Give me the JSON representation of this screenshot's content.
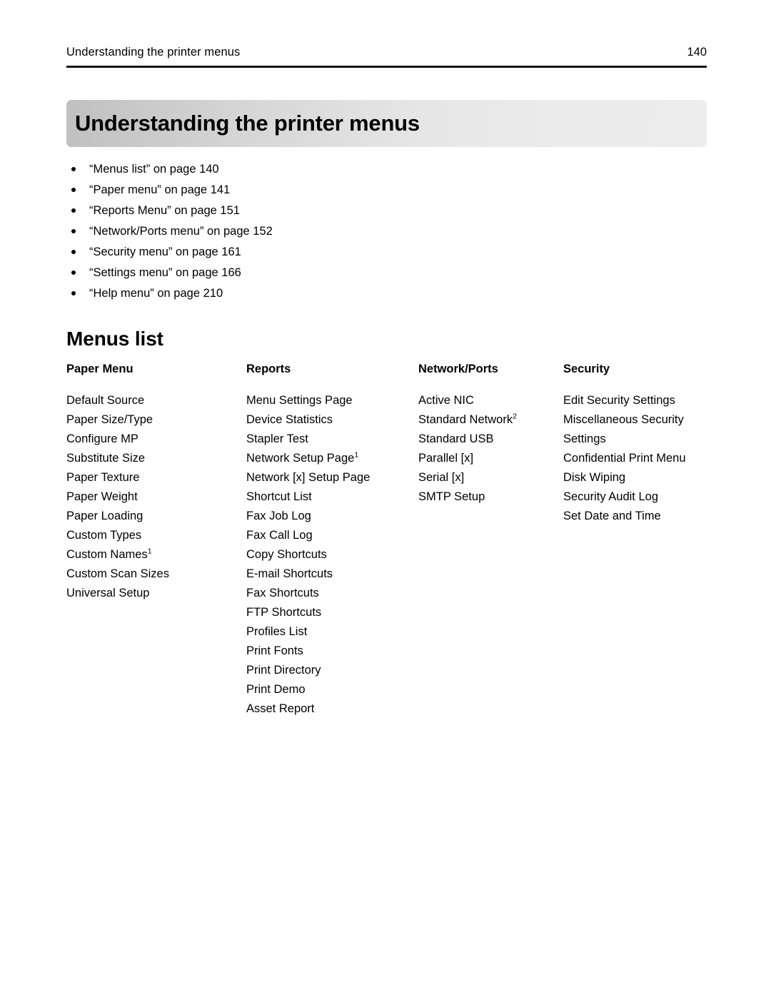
{
  "running_header": {
    "title": "Understanding the printer menus",
    "page_number": "140"
  },
  "chapter": {
    "title": "Understanding the printer menus"
  },
  "toc_links": [
    {
      "text": "“Menus list” on page 140"
    },
    {
      "text": "“Paper menu” on page 141"
    },
    {
      "text": "“Reports Menu” on page 151"
    },
    {
      "text": "“Network/Ports menu” on page 152"
    },
    {
      "text": "“Security menu” on page 161"
    },
    {
      "text": "“Settings menu” on page 166"
    },
    {
      "text": "“Help menu” on page 210"
    }
  ],
  "section": {
    "heading": "Menus list"
  },
  "menus_table": {
    "columns": [
      {
        "header": "Paper Menu",
        "items": [
          {
            "label": "Default Source",
            "sup": ""
          },
          {
            "label": "Paper Size/Type",
            "sup": ""
          },
          {
            "label": "Configure MP",
            "sup": ""
          },
          {
            "label": "Substitute Size",
            "sup": ""
          },
          {
            "label": "Paper Texture",
            "sup": ""
          },
          {
            "label": "Paper Weight",
            "sup": ""
          },
          {
            "label": "Paper Loading",
            "sup": ""
          },
          {
            "label": "Custom Types",
            "sup": ""
          },
          {
            "label": "Custom Names",
            "sup": "1"
          },
          {
            "label": "Custom Scan Sizes",
            "sup": ""
          },
          {
            "label": "Universal Setup",
            "sup": ""
          }
        ]
      },
      {
        "header": "Reports",
        "items": [
          {
            "label": "Menu Settings Page",
            "sup": ""
          },
          {
            "label": "Device Statistics",
            "sup": ""
          },
          {
            "label": "Stapler Test",
            "sup": ""
          },
          {
            "label": "Network Setup Page",
            "sup": "1"
          },
          {
            "label": "Network [x] Setup Page",
            "sup": ""
          },
          {
            "label": "Shortcut List",
            "sup": ""
          },
          {
            "label": "Fax Job Log",
            "sup": ""
          },
          {
            "label": "Fax Call Log",
            "sup": ""
          },
          {
            "label": "Copy Shortcuts",
            "sup": ""
          },
          {
            "label": "E-mail Shortcuts",
            "sup": ""
          },
          {
            "label": "Fax Shortcuts",
            "sup": ""
          },
          {
            "label": "FTP Shortcuts",
            "sup": ""
          },
          {
            "label": "Profiles List",
            "sup": ""
          },
          {
            "label": "Print Fonts",
            "sup": ""
          },
          {
            "label": "Print Directory",
            "sup": ""
          },
          {
            "label": "Print Demo",
            "sup": ""
          },
          {
            "label": "Asset Report",
            "sup": ""
          }
        ]
      },
      {
        "header": "Network/Ports",
        "items": [
          {
            "label": "Active NIC",
            "sup": ""
          },
          {
            "label": "Standard Network",
            "sup": "2"
          },
          {
            "label": "Standard USB",
            "sup": ""
          },
          {
            "label": "Parallel [x]",
            "sup": ""
          },
          {
            "label": "Serial [x]",
            "sup": ""
          },
          {
            "label": "SMTP Setup",
            "sup": ""
          }
        ]
      },
      {
        "header": "Security",
        "items": [
          {
            "label": "Edit Security Settings",
            "sup": ""
          },
          {
            "label": "Miscellaneous Security Settings",
            "sup": ""
          },
          {
            "label": "Confidential Print Menu",
            "sup": ""
          },
          {
            "label": "Disk Wiping",
            "sup": ""
          },
          {
            "label": "Security Audit Log",
            "sup": ""
          },
          {
            "label": "Set Date and Time",
            "sup": ""
          }
        ]
      }
    ]
  }
}
